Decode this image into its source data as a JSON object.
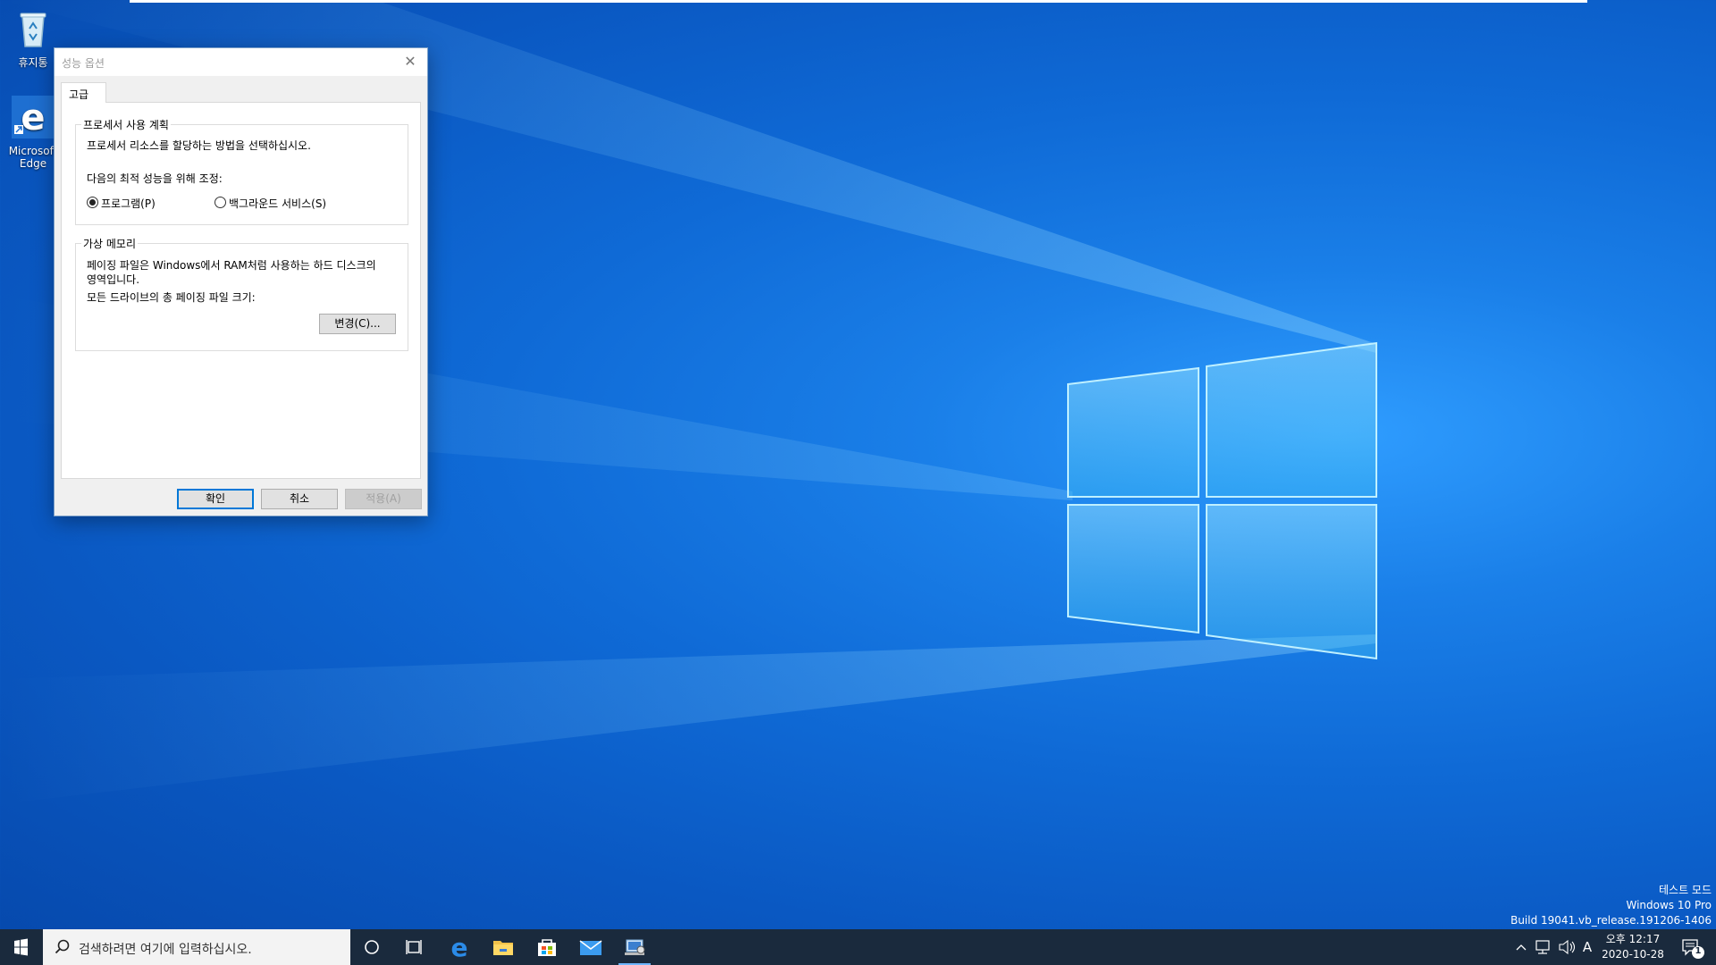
{
  "desktop": {
    "icons": [
      {
        "label": "휴지통"
      },
      {
        "label": "Microsoft Edge"
      }
    ],
    "watermark": {
      "line1": "테스트 모드",
      "line2": "Windows 10 Pro",
      "line3": "Build 19041.vb_release.191206-1406"
    }
  },
  "dialog": {
    "title": "성능 옵션",
    "close_glyph": "✕",
    "tab_label": "고급",
    "processor_group": {
      "legend": "프로세서 사용 계획",
      "description": "프로세서 리소스를 할당하는 방법을 선택하십시오.",
      "adjust_label": "다음의 최적 성능을 위해 조정:",
      "option_programs": "프로그램(P)",
      "option_background": "백그라운드 서비스(S)",
      "selected": "programs"
    },
    "vm_group": {
      "legend": "가상 메모리",
      "description_line1": "페이징 파일은 Windows에서 RAM처럼 사용하는 하드 디스크의",
      "description_line2": "영역입니다.",
      "total_label": "모든 드라이브의 총 페이징 파일 크기:",
      "change_button": "변경(C)..."
    },
    "buttons": {
      "ok": "확인",
      "cancel": "취소",
      "apply": "적용(A)"
    }
  },
  "taskbar": {
    "search_placeholder": "검색하려면 여기에 입력하십시오.",
    "apps": [
      "cortana-icon",
      "task-view-icon",
      "edge-icon",
      "file-explorer-icon",
      "store-icon",
      "mail-icon",
      "performance-options-icon"
    ],
    "tray": {
      "ime": "A",
      "time": "오후 12:17",
      "date": "2020-10-28",
      "notification_count": "1"
    }
  },
  "colors": {
    "accent": "#0078d7",
    "taskbar": "#1a2a3d",
    "wallpaper": "#0a66d0"
  }
}
